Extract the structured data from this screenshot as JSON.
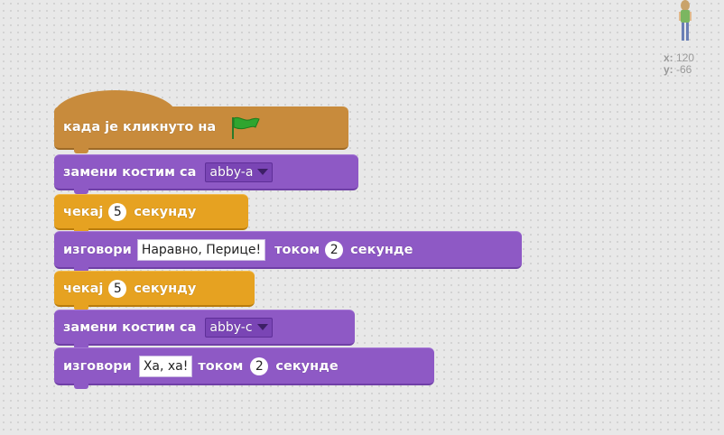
{
  "sprite": {
    "icon": "abby-sprite-icon"
  },
  "coords": {
    "x_label": "x:",
    "x_value": "120",
    "y_label": "y:",
    "y_value": "-66"
  },
  "script": {
    "hat": {
      "label": "када је кликнуто на",
      "icon": "green-flag-icon"
    },
    "switch1": {
      "label": "замени костим са",
      "costume": "abby-a"
    },
    "wait1": {
      "label": "чекај",
      "value": "5",
      "unit": "секунду"
    },
    "say1": {
      "label": "изговори",
      "text": "Наравно, Перице!",
      "for_label": "током",
      "secs": "2",
      "unit": "секунде"
    },
    "wait2": {
      "label": "чекај",
      "value": "5",
      "unit": "секунду"
    },
    "switch2": {
      "label": "замени костим са",
      "costume": "abby-c"
    },
    "say2": {
      "label": "изговори",
      "text": "Ха, ха!",
      "for_label": "током",
      "secs": "2",
      "unit": "секунде"
    }
  },
  "colors": {
    "looks": "#8e59c5",
    "control": "#e6a221",
    "events": "#c88b3c",
    "flag": "#2fa52f"
  }
}
